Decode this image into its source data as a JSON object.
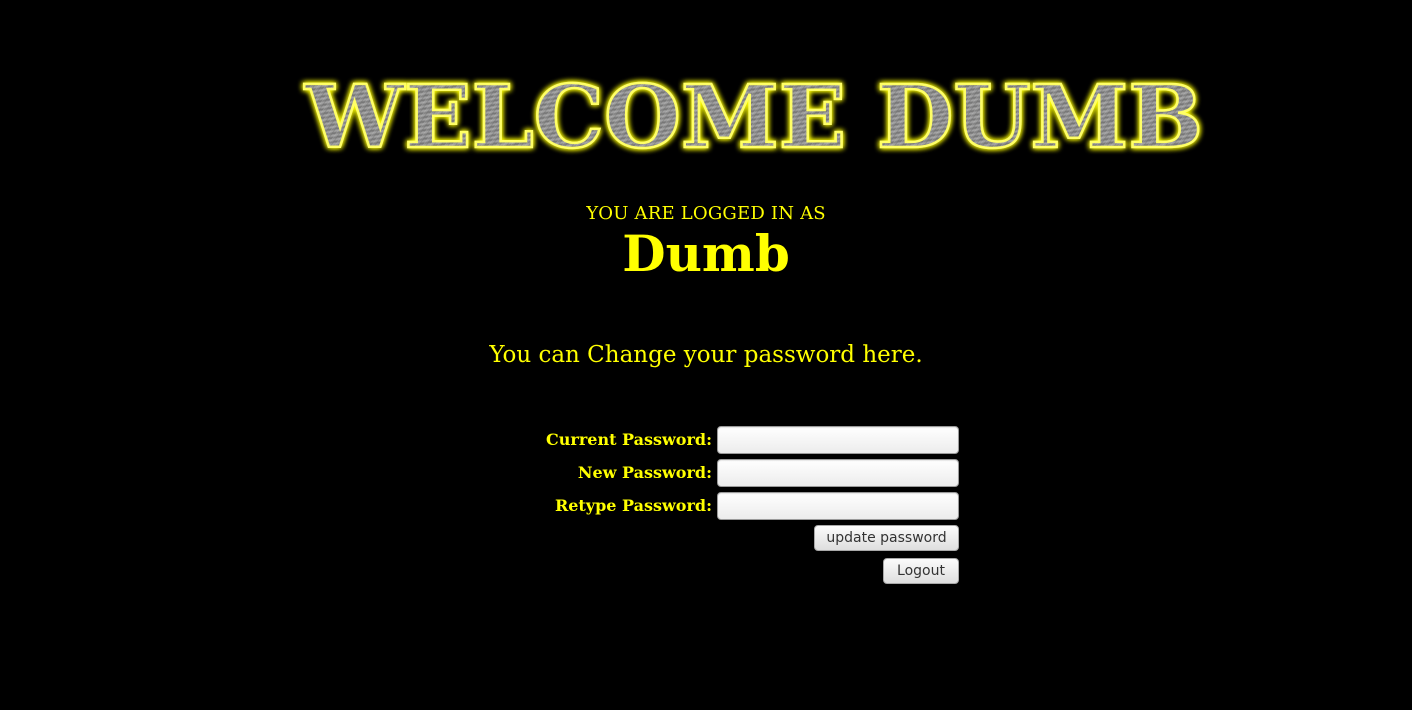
{
  "banner": {
    "text": "WELCOME DUMB",
    "glow_color": "#ffff00",
    "metal_color": "#8a8a8a"
  },
  "login": {
    "label": "YOU ARE LOGGED IN AS",
    "username": "Dumb"
  },
  "intro": "You can Change your password here.",
  "form": {
    "current_label": "Current Password:",
    "current_value": "",
    "new_label": "New Password:",
    "new_value": "",
    "retype_label": "Retype Password:",
    "retype_value": "",
    "submit_label": "update password",
    "logout_label": "Logout"
  },
  "theme": {
    "background": "#000000",
    "text_color": "#ffff00"
  }
}
